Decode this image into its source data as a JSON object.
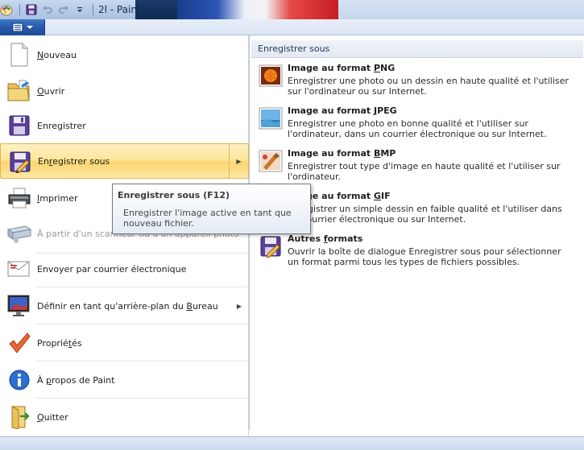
{
  "window": {
    "title": "2l - Paint",
    "colors": {
      "titlebar": "#b9cde8",
      "file_button": "#2859a9",
      "hover": "#fde69b"
    }
  },
  "quick_access": {
    "icons": [
      "paint-app-icon",
      "save-icon",
      "undo-icon",
      "redo-icon",
      "customize-dropdown-icon"
    ]
  },
  "file_menu": {
    "items": [
      {
        "id": "nouveau",
        "label": "Nouveau",
        "icon": "new-document-icon"
      },
      {
        "id": "ouvrir",
        "label": "Ouvrir",
        "icon": "open-folder-icon"
      },
      {
        "id": "enregistrer",
        "label": "Enregistrer",
        "icon": "floppy-disk-icon"
      },
      {
        "id": "enregistrer-sous",
        "label": "Enregistrer sous",
        "icon": "save-as-icon",
        "has_submenu": true,
        "highlighted": true
      },
      {
        "id": "imprimer",
        "label": "Imprimer",
        "icon": "printer-icon"
      },
      {
        "id": "scanner",
        "label": "À partir d'un scanneur ou d'un appareil photo",
        "icon": "scanner-icon",
        "disabled": true
      },
      {
        "id": "envoyer",
        "label": "Envoyer par courrier électronique",
        "icon": "email-icon"
      },
      {
        "id": "arriere-plan",
        "label": "Définir en tant qu'arrière-plan du Bureau",
        "icon": "desktop-background-icon",
        "has_submenu": true
      },
      {
        "id": "proprietes",
        "label": "Propriétés",
        "icon": "checkmark-icon"
      },
      {
        "id": "apropos",
        "label": "À propos de Paint",
        "icon": "info-icon"
      },
      {
        "id": "quitter",
        "label": "Quitter",
        "icon": "exit-icon"
      }
    ]
  },
  "save_as_panel": {
    "header": "Enregistrer sous",
    "items": [
      {
        "title": "Image au format PNG",
        "description": "Enregistrer une photo ou un dessin en haute qualité et l'utiliser sur l'ordinateur ou sur Internet.",
        "icon": "png-image-icon"
      },
      {
        "title": "Image au format JPEG",
        "description": "Enregistrer une photo en bonne qualité et l'utiliser sur l'ordinateur, dans un courrier électronique ou sur Internet.",
        "icon": "jpeg-image-icon"
      },
      {
        "title": "Image au format BMP",
        "description": "Enregistrer tout type d'image en haute qualité et l'utiliser sur l'ordinateur.",
        "icon": "bmp-image-icon"
      },
      {
        "title": "Image au format GIF",
        "description": "Enregistrer un simple dessin en faible qualité et l'utiliser dans un courrier électronique ou sur Internet.",
        "icon": "gif-image-icon"
      },
      {
        "title": "Autres formats",
        "description": "Ouvrir la boîte de dialogue Enregistrer sous pour sélectionner un format parmi tous les types de fichiers possibles.",
        "icon": "other-formats-icon"
      }
    ]
  },
  "tooltip": {
    "title": "Enregistrer sous (F12)",
    "body": "Enregistrer l'image active en tant que nouveau fichier."
  }
}
